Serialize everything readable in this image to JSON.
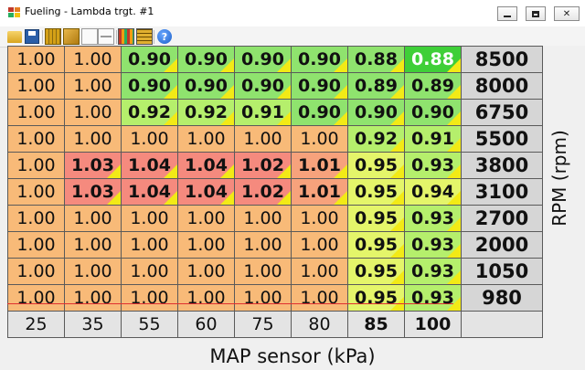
{
  "window": {
    "title": "Fueling - Lambda trgt. #1",
    "buttons": {
      "minimize": "minimize",
      "maximize": "maximize",
      "close": "close"
    }
  },
  "toolbar": {
    "items": [
      {
        "name": "open-icon"
      },
      {
        "name": "save-icon"
      },
      {
        "name": "grid-view-icon"
      },
      {
        "name": "fill-icon"
      },
      {
        "name": "blank-table-icon"
      },
      {
        "name": "row-table-icon"
      },
      {
        "name": "color-map-icon"
      },
      {
        "name": "smooth-map-icon"
      },
      {
        "name": "help-icon"
      }
    ]
  },
  "axes": {
    "y_label": "RPM (rpm)",
    "x_label": "MAP sensor (kPa)",
    "rpm": [
      "8500",
      "8000",
      "6750",
      "5500",
      "3800",
      "3100",
      "2700",
      "2000",
      "1050",
      "980"
    ],
    "map": [
      "25",
      "35",
      "55",
      "60",
      "75",
      "80",
      "85",
      "100"
    ],
    "map_bold": [
      false,
      false,
      false,
      false,
      false,
      false,
      true,
      true
    ]
  },
  "table": {
    "rows": [
      [
        "1.00",
        "1.00",
        "0.90",
        "0.90",
        "0.90",
        "0.90",
        "0.88",
        "0.88"
      ],
      [
        "1.00",
        "1.00",
        "0.90",
        "0.90",
        "0.90",
        "0.90",
        "0.89",
        "0.89"
      ],
      [
        "1.00",
        "1.00",
        "0.92",
        "0.92",
        "0.91",
        "0.90",
        "0.90",
        "0.90"
      ],
      [
        "1.00",
        "1.00",
        "1.00",
        "1.00",
        "1.00",
        "1.00",
        "0.92",
        "0.91"
      ],
      [
        "1.00",
        "1.03",
        "1.04",
        "1.04",
        "1.02",
        "1.01",
        "0.95",
        "0.93"
      ],
      [
        "1.00",
        "1.03",
        "1.04",
        "1.04",
        "1.02",
        "1.01",
        "0.95",
        "0.94"
      ],
      [
        "1.00",
        "1.00",
        "1.00",
        "1.00",
        "1.00",
        "1.00",
        "0.95",
        "0.93"
      ],
      [
        "1.00",
        "1.00",
        "1.00",
        "1.00",
        "1.00",
        "1.00",
        "0.95",
        "0.93"
      ],
      [
        "1.00",
        "1.00",
        "1.00",
        "1.00",
        "1.00",
        "1.00",
        "0.95",
        "0.93"
      ],
      [
        "1.00",
        "1.00",
        "1.00",
        "1.00",
        "1.00",
        "1.00",
        "0.95",
        "0.93"
      ]
    ],
    "colors": {
      "orange": "#f8ba78",
      "red": "#f58a7e",
      "green": "#8fe36e",
      "light_green": "#b5ef6c",
      "yellow_green": "#e4f56a",
      "selected": "#3fcf38",
      "marker": "#f2ea16",
      "header_bg": "#d6d6d6"
    },
    "selected_cell": {
      "row": 0,
      "col": 7
    }
  }
}
